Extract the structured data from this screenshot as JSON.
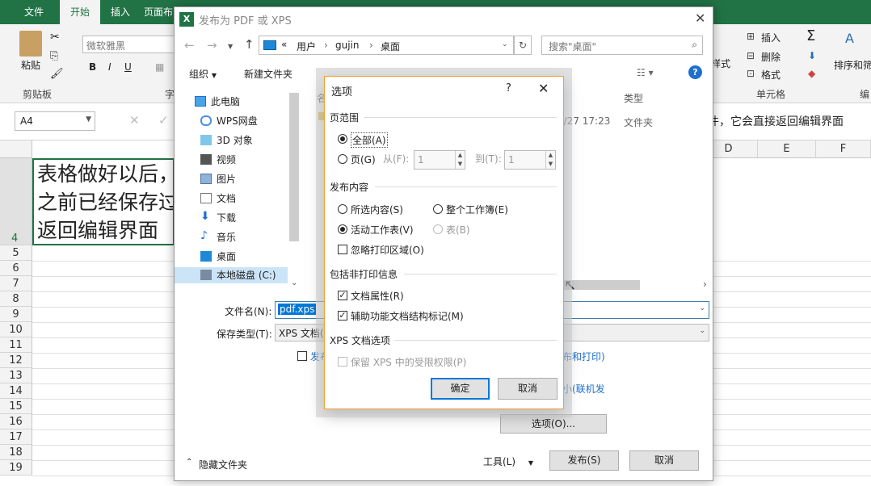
{
  "excel": {
    "tabs": [
      "文件",
      "开始",
      "插入",
      "页面布"
    ],
    "font_name": "微软雅黑",
    "clipboard": {
      "paste": "粘贴",
      "label": "剪贴板"
    },
    "font_group_label": "字",
    "bold": "B",
    "italic": "I",
    "underline": "U",
    "cells": {
      "insert": "插入",
      "delete": "删除",
      "format": "格式",
      "label": "单元格"
    },
    "styles_label": "样式",
    "sort_filter": "排序和筛",
    "edit_label": "编",
    "name_box": "A4",
    "formula_text": "件，它会直接返回编辑界面",
    "columns": [
      "D",
      "E",
      "F"
    ],
    "rows": [
      "4",
      "5",
      "6",
      "7",
      "8",
      "9",
      "10",
      "11",
      "12",
      "13",
      "14",
      "15",
      "16",
      "17",
      "18",
      "19"
    ],
    "cell_text": [
      "表格做好以后，",
      "之前已经保存过",
      "返回编辑界面"
    ]
  },
  "publish_dialog": {
    "title": "发布为 PDF 或 XPS",
    "breadcrumb": [
      "«",
      "用户",
      "gujin",
      "桌面"
    ],
    "search_placeholder": "搜索\"桌面\"",
    "organize": "组织",
    "new_folder": "新建文件夹",
    "help": "?",
    "nav_items": [
      "此电脑",
      "WPS网盘",
      "3D 对象",
      "视频",
      "图片",
      "文档",
      "下载",
      "音乐",
      "桌面",
      "本地磁盘 (C:)"
    ],
    "col_name": "名",
    "col_type": "类型",
    "file_date": "0/27 17:23",
    "file_type": "文件夹",
    "filename_label": "文件名(N):",
    "filename_value": "pdf.xps",
    "savetype_label": "保存类型(T):",
    "savetype_value": "XPS 文档(",
    "publish_check_label": "发布",
    "standard_label": "布和打印)",
    "minimal_label": "小(联机发",
    "options_button": "选项(O)...",
    "hide_folders": "隐藏文件夹",
    "tools": "工具(L)",
    "publish_button": "发布(S)",
    "cancel_button": "取消"
  },
  "options_dialog": {
    "title": "选项",
    "help": "?",
    "page_range": {
      "heading": "页范围",
      "all": "全部(A)",
      "pages": "页(G)",
      "from_label": "从(F):",
      "from_value": "1",
      "to_label": "到(T):",
      "to_value": "1"
    },
    "publish_what": {
      "heading": "发布内容",
      "selection": "所选内容(S)",
      "entire_workbook": "整个工作簿(E)",
      "active_sheets": "活动工作表(V)",
      "table": "表(B)",
      "ignore_print_areas": "忽略打印区域(O)"
    },
    "non_printing": {
      "heading": "包括非打印信息",
      "doc_properties": "文档属性(R)",
      "doc_properties_checked": true,
      "accessibility_tags": "辅助功能文档结构标记(M)",
      "accessibility_tags_checked": true
    },
    "xps_options": {
      "heading": "XPS 文档选项",
      "preserve_irm": "保留 XPS 中的受限权限(P)"
    },
    "ok": "确定",
    "cancel": "取消"
  }
}
